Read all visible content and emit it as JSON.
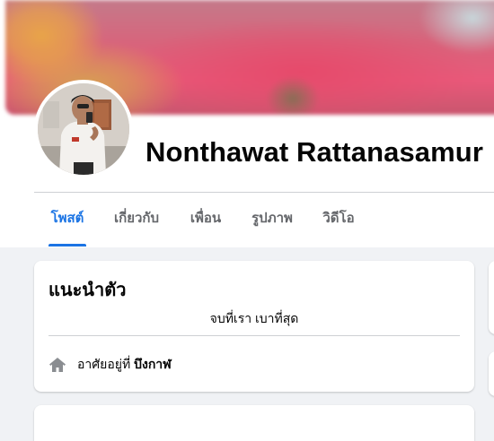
{
  "profile": {
    "name": "Nonthawat Rattanasamur"
  },
  "tabs": [
    {
      "label": "โพสต์",
      "active": true
    },
    {
      "label": "เกี่ยวกับ",
      "active": false
    },
    {
      "label": "เพื่อน",
      "active": false
    },
    {
      "label": "รูปภาพ",
      "active": false
    },
    {
      "label": "วิดีโอ",
      "active": false
    }
  ],
  "intro": {
    "title": "แนะนำตัว",
    "bio": "จบที่เรา เบาที่สุด",
    "lives_in_prefix": "อาศัยอยู่ที่",
    "lives_in_place": "บึงกาฬ",
    "lives_in_icon": "home-icon"
  },
  "colors": {
    "accent": "#1b74e4",
    "background": "#f0f2f5",
    "card": "#ffffff",
    "secondary_text": "#65676b"
  }
}
